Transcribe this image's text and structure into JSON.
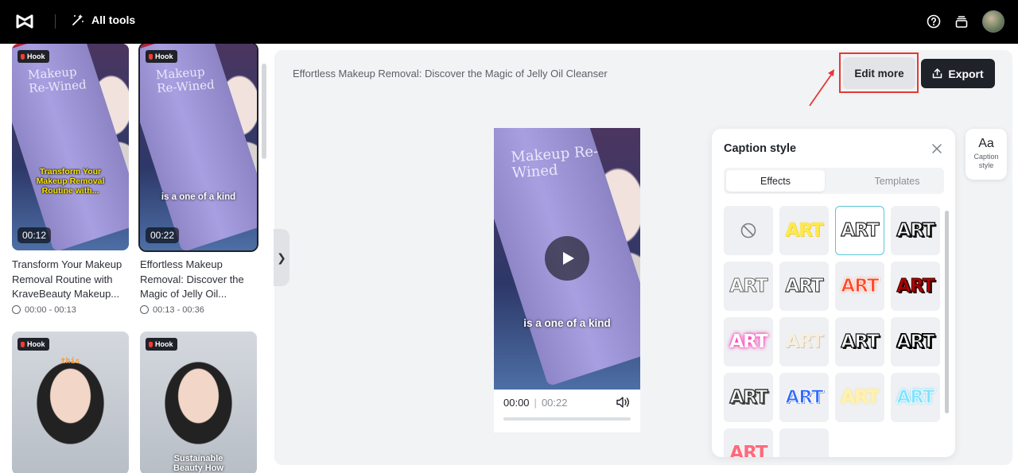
{
  "topbar": {
    "all_tools_label": "All tools",
    "help_icon": "help-circle-icon",
    "stack_icon": "stack-icon"
  },
  "clips": [
    {
      "badge": "Hook",
      "duration": "00:12",
      "overlay": "Transform Your Makeup Removal Routine with...",
      "title": "Transform Your Makeup Removal Routine with KraveBeauty Makeup...",
      "range": "00:00 - 00:13"
    },
    {
      "badge": "Hook",
      "duration": "00:22",
      "overlay": "is a one of a kind",
      "title": "Effortless Makeup Removal: Discover the Magic of Jelly Oil...",
      "range": "00:13 - 00:36"
    },
    {
      "badge": "Hook",
      "overlay": "this"
    },
    {
      "badge": "Hook",
      "overlay": "Sustainable Beauty How"
    }
  ],
  "product_text": "Makeup Re-Wined",
  "main": {
    "video_title": "Effortless Makeup Removal: Discover the Magic of Jelly Oil Cleanser",
    "edit_more_label": "Edit more",
    "export_label": "Export",
    "collapse_glyph": "❯"
  },
  "player": {
    "caption": "is a one of a kind",
    "current": "00:00",
    "separator": "|",
    "total": "00:22",
    "progress": 0
  },
  "caption_panel": {
    "title": "Caption style",
    "tabs": [
      "Effects",
      "Templates"
    ],
    "active_tab": "Effects",
    "tile_text": "ART"
  },
  "side": {
    "aa": "Aa",
    "label": "Caption style"
  },
  "colors": {
    "topbar": "#000000",
    "accent_red": "#e53935",
    "dark_button": "#1f2329",
    "selection": "#5bc6d6"
  }
}
